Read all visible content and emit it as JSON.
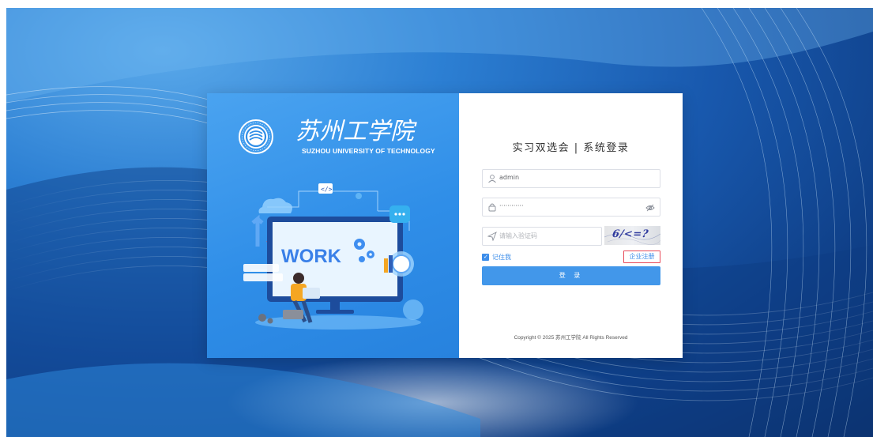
{
  "brand": {
    "name_cn": "苏州工学院",
    "name_en": "SUZHOU UNIVERSITY OF TECHNOLOGY"
  },
  "illustration": {
    "work_text": "WORK",
    "code_tag": "</>"
  },
  "login": {
    "title": "实习双选会 | 系统登录",
    "username_value": "admin",
    "password_value": "············",
    "captcha_placeholder": "请输入验证码",
    "captcha_image_text": "6/<=?",
    "remember_label": "记住我",
    "remember_checked": true,
    "register_link": "企业注册",
    "submit_label": "登 录",
    "copyright": "Copyright © 2025 苏州工学院 All Rights Reserved"
  },
  "colors": {
    "primary": "#4297ea",
    "left_panel": "#2f8ee8",
    "highlight_border": "#e84b5a",
    "background_deep": "#0f3f87"
  },
  "icons": {
    "username": "user-icon",
    "password": "lock-icon",
    "captcha": "send-icon",
    "password_toggle": "eye-icon"
  }
}
